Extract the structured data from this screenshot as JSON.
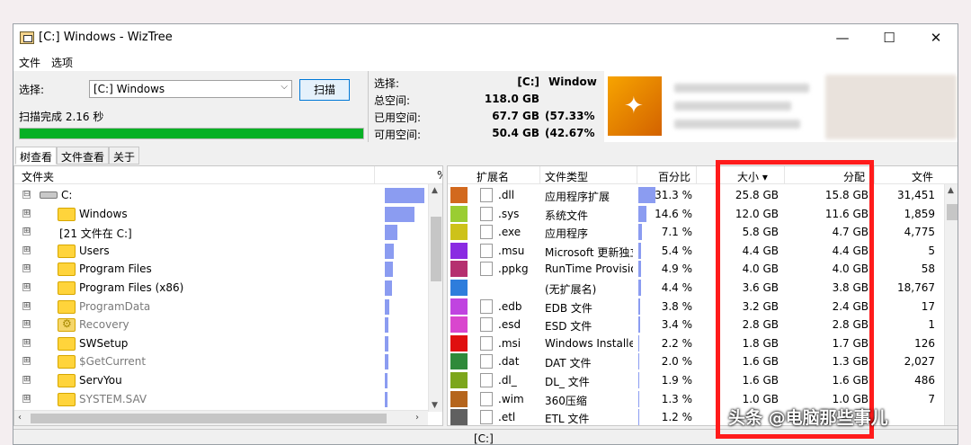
{
  "window": {
    "title": "[C:] Windows  - WizTree"
  },
  "window_controls": {
    "minimize": "—",
    "maximize": "☐",
    "close": "✕"
  },
  "menu": [
    "文件",
    "选项"
  ],
  "scan": {
    "select_label": "选择:",
    "drive_value": "[C:] Windows",
    "scan_button": "扫描",
    "status": "扫描完成 2.16 秒",
    "progress_percent": 100
  },
  "disk_info": {
    "select_label": "选择:",
    "select_value": "[C:]",
    "select_name": "Window",
    "total_label": "总空间:",
    "total_value": "118.0 GB",
    "used_label": "已用空间:",
    "used_value": "67.7 GB",
    "used_pct": "(57.33%",
    "free_label": "可用空间:",
    "free_value": "50.4 GB",
    "free_pct": "(42.67%"
  },
  "tabs": [
    "树查看",
    "文件查看",
    "关于"
  ],
  "tree": {
    "header_folder": "文件夹",
    "header_extra": "%",
    "rows": [
      {
        "expander": "⊟",
        "label": "C:",
        "type": "drive",
        "bar": 1.0
      },
      {
        "expander": "⊞",
        "label": "Windows",
        "type": "folder",
        "bar": 0.75
      },
      {
        "expander": "⊞",
        "label": "[21 文件在 C:]",
        "type": "none",
        "bar": 0.32
      },
      {
        "expander": "⊞",
        "label": "Users",
        "type": "folder",
        "bar": 0.22
      },
      {
        "expander": "⊞",
        "label": "Program Files",
        "type": "folder",
        "bar": 0.2
      },
      {
        "expander": "⊞",
        "label": "Program Files (x86)",
        "type": "folder",
        "bar": 0.18
      },
      {
        "expander": "⊞",
        "label": "ProgramData",
        "type": "folder",
        "bar": 0.12,
        "gray": true
      },
      {
        "expander": "⊞",
        "label": "Recovery",
        "type": "gear",
        "bar": 0.1,
        "gray": true
      },
      {
        "expander": "⊞",
        "label": "SWSetup",
        "type": "folder",
        "bar": 0.1
      },
      {
        "expander": "⊞",
        "label": "$GetCurrent",
        "type": "folder",
        "bar": 0.08,
        "gray": true
      },
      {
        "expander": "⊞",
        "label": "ServYou",
        "type": "folder",
        "bar": 0.07
      },
      {
        "expander": "⊞",
        "label": "SYSTEM.SAV",
        "type": "folder",
        "bar": 0.06,
        "gray": true
      }
    ]
  },
  "ext_table": {
    "headers": {
      "ext": "扩展名",
      "type": "文件类型",
      "pct": "百分比",
      "size": "大小 ▾",
      "alloc": "分配",
      "files": "文件"
    },
    "rows": [
      {
        "color": "#d2691e",
        "ext": ".dll",
        "type": "应用程序扩展",
        "pct": "31.3 %",
        "pct_val": 31.3,
        "size": "25.8 GB",
        "alloc": "15.8 GB",
        "files": "31,451"
      },
      {
        "color": "#9acd32",
        "ext": ".sys",
        "type": "系统文件",
        "pct": "14.6 %",
        "pct_val": 14.6,
        "size": "12.0 GB",
        "alloc": "11.6 GB",
        "files": "1,859"
      },
      {
        "color": "#cdc21a",
        "ext": ".exe",
        "type": "应用程序",
        "pct": "7.1 %",
        "pct_val": 7.1,
        "size": "5.8 GB",
        "alloc": "4.7 GB",
        "files": "4,775"
      },
      {
        "color": "#8a2be2",
        "ext": ".msu",
        "type": "Microsoft 更新独立",
        "pct": "5.4 %",
        "pct_val": 5.4,
        "size": "4.4 GB",
        "alloc": "4.4 GB",
        "files": "5"
      },
      {
        "color": "#b5306f",
        "ext": ".ppkg",
        "type": "RunTime Provision",
        "pct": "4.9 %",
        "pct_val": 4.9,
        "size": "4.0 GB",
        "alloc": "4.0 GB",
        "files": "58"
      },
      {
        "color": "#2e7ddc",
        "ext": "",
        "type": "(无扩展名)",
        "pct": "4.4 %",
        "pct_val": 4.4,
        "size": "3.6 GB",
        "alloc": "3.8 GB",
        "files": "18,767"
      },
      {
        "color": "#c044e0",
        "ext": ".edb",
        "type": "EDB 文件",
        "pct": "3.8 %",
        "pct_val": 3.8,
        "size": "3.2 GB",
        "alloc": "2.4 GB",
        "files": "17"
      },
      {
        "color": "#d946ce",
        "ext": ".esd",
        "type": "ESD 文件",
        "pct": "3.4 %",
        "pct_val": 3.4,
        "size": "2.8 GB",
        "alloc": "2.8 GB",
        "files": "1"
      },
      {
        "color": "#e01010",
        "ext": ".msi",
        "type": "Windows Installer",
        "pct": "2.2 %",
        "pct_val": 2.2,
        "size": "1.8 GB",
        "alloc": "1.7 GB",
        "files": "126"
      },
      {
        "color": "#2f8a3a",
        "ext": ".dat",
        "type": "DAT 文件",
        "pct": "2.0 %",
        "pct_val": 2.0,
        "size": "1.6 GB",
        "alloc": "1.3 GB",
        "files": "2,027"
      },
      {
        "color": "#7ca61c",
        "ext": ".dl_",
        "type": "DL_ 文件",
        "pct": "1.9 %",
        "pct_val": 1.9,
        "size": "1.6 GB",
        "alloc": "1.6 GB",
        "files": "486"
      },
      {
        "color": "#b5651d",
        "ext": ".wim",
        "type": "360压缩",
        "pct": "1.3 %",
        "pct_val": 1.3,
        "size": "1.0 GB",
        "alloc": "1.0 GB",
        "files": "7"
      },
      {
        "color": "#606060",
        "ext": ".etl",
        "type": "ETL 文件",
        "pct": "1.2 %",
        "pct_val": 1.2,
        "size": "",
        "alloc": "",
        "files": ""
      }
    ]
  },
  "statusbar": {
    "text": "[C:]"
  },
  "watermark": "头条 @电脑那些事儿",
  "colors": {
    "progress": "#06b025",
    "bar": "#8b9cf1",
    "highlight": "#ff1b1b"
  }
}
